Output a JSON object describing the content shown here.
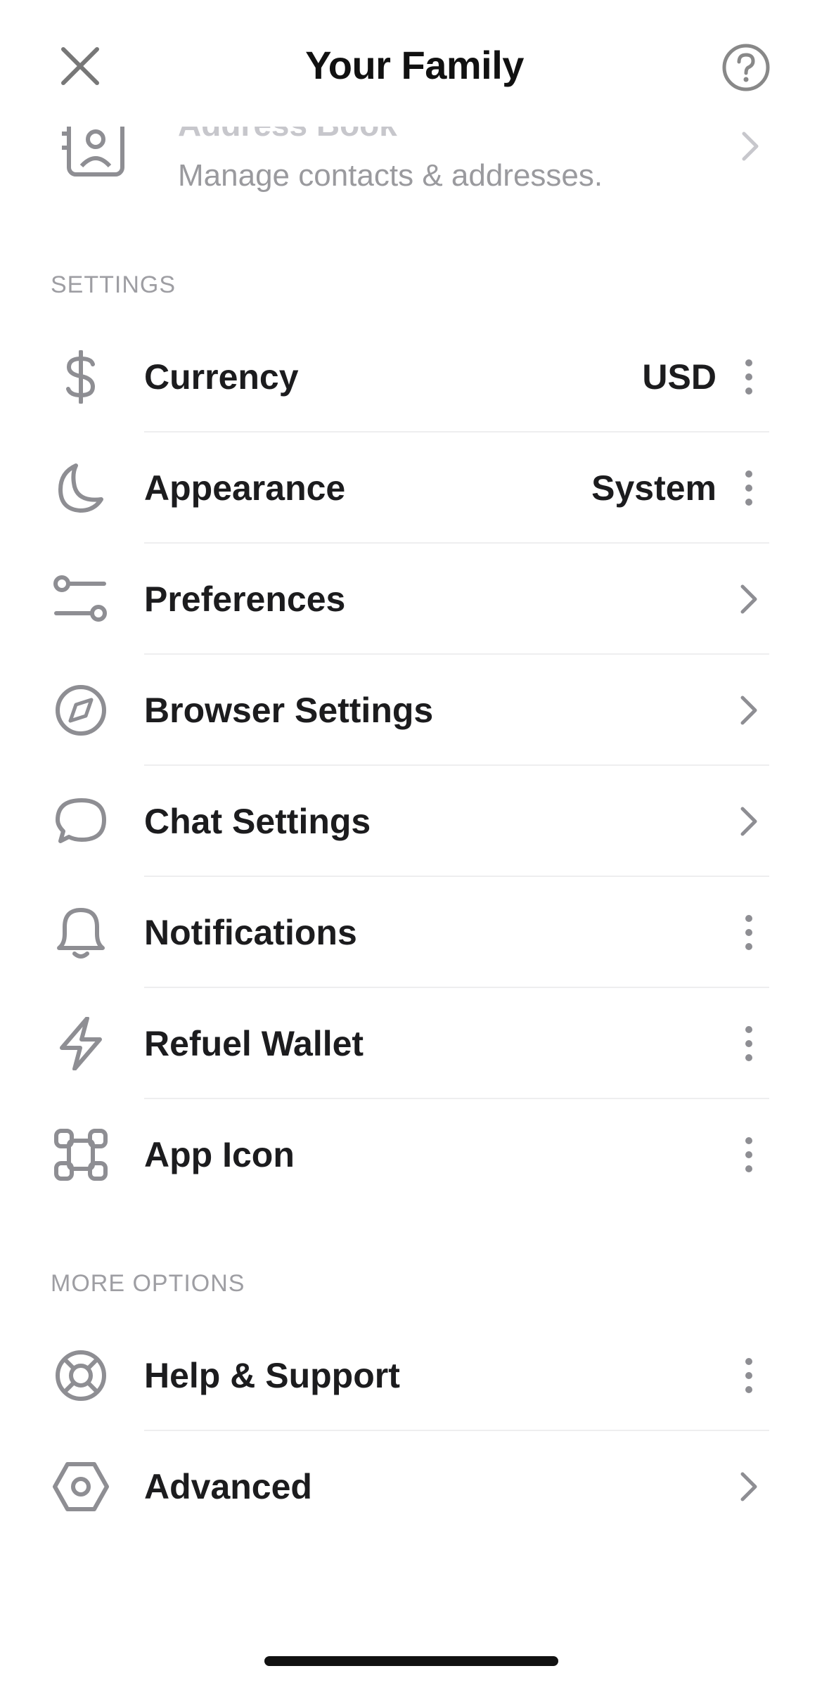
{
  "header": {
    "title": "Your Family",
    "close_icon": "close-icon",
    "help_icon": "help-icon"
  },
  "address_book": {
    "title": "Address Book",
    "subtitle": "Manage contacts & addresses."
  },
  "settings_section": {
    "header": "SETTINGS",
    "items": [
      {
        "label": "Currency",
        "value": "USD",
        "icon": "dollar-icon",
        "trailing": "more-icon"
      },
      {
        "label": "Appearance",
        "value": "System",
        "icon": "moon-icon",
        "trailing": "more-icon"
      },
      {
        "label": "Preferences",
        "value": "",
        "icon": "sliders-icon",
        "trailing": "chevron-right-icon"
      },
      {
        "label": "Browser Settings",
        "value": "",
        "icon": "compass-icon",
        "trailing": "chevron-right-icon"
      },
      {
        "label": "Chat Settings",
        "value": "",
        "icon": "chat-bubble-icon",
        "trailing": "chevron-right-icon"
      },
      {
        "label": "Notifications",
        "value": "",
        "icon": "bell-icon",
        "trailing": "more-icon"
      },
      {
        "label": "Refuel Wallet",
        "value": "",
        "icon": "lightning-icon",
        "trailing": "more-icon"
      },
      {
        "label": "App Icon",
        "value": "",
        "icon": "app-grid-icon",
        "trailing": "more-icon"
      }
    ]
  },
  "more_options_section": {
    "header": "MORE OPTIONS",
    "items": [
      {
        "label": "Help & Support",
        "value": "",
        "icon": "lifebuoy-icon",
        "trailing": "more-icon"
      },
      {
        "label": "Advanced",
        "value": "",
        "icon": "hexagon-nut-icon",
        "trailing": "chevron-right-icon"
      }
    ]
  },
  "colors": {
    "text_primary": "#1c1c1e",
    "text_secondary": "#9a9a9e",
    "icon_gray": "#8e8e93",
    "divider": "#eeeeef",
    "background": "#ffffff"
  }
}
